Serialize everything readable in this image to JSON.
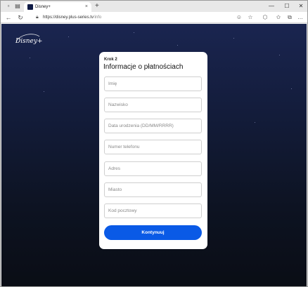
{
  "browser": {
    "tab_title": "Disney+",
    "tab_close": "×",
    "new_tab": "+",
    "url_host": "https://disney.plus-series.tv",
    "url_path": "/info",
    "window_controls": {
      "minimize": "—",
      "maximize": "☐",
      "close": "✕"
    }
  },
  "page": {
    "logo": "Disney+",
    "form": {
      "step": "Krok 2",
      "title": "Informacje o płatnościach",
      "fields": [
        {
          "placeholder": "Imię"
        },
        {
          "placeholder": "Nazwisko"
        },
        {
          "placeholder": "Data urodzenia (DD/MM/RRRR)"
        },
        {
          "placeholder": "Numer telefonu"
        },
        {
          "placeholder": "Adres"
        },
        {
          "placeholder": "Miasto"
        },
        {
          "placeholder": "Kod pocztowy"
        }
      ],
      "submit_label": "Kontynuuj"
    }
  },
  "colors": {
    "accent": "#0a5ae6",
    "page_bg_top": "#1a2550",
    "page_bg_bottom": "#0a0d15"
  }
}
